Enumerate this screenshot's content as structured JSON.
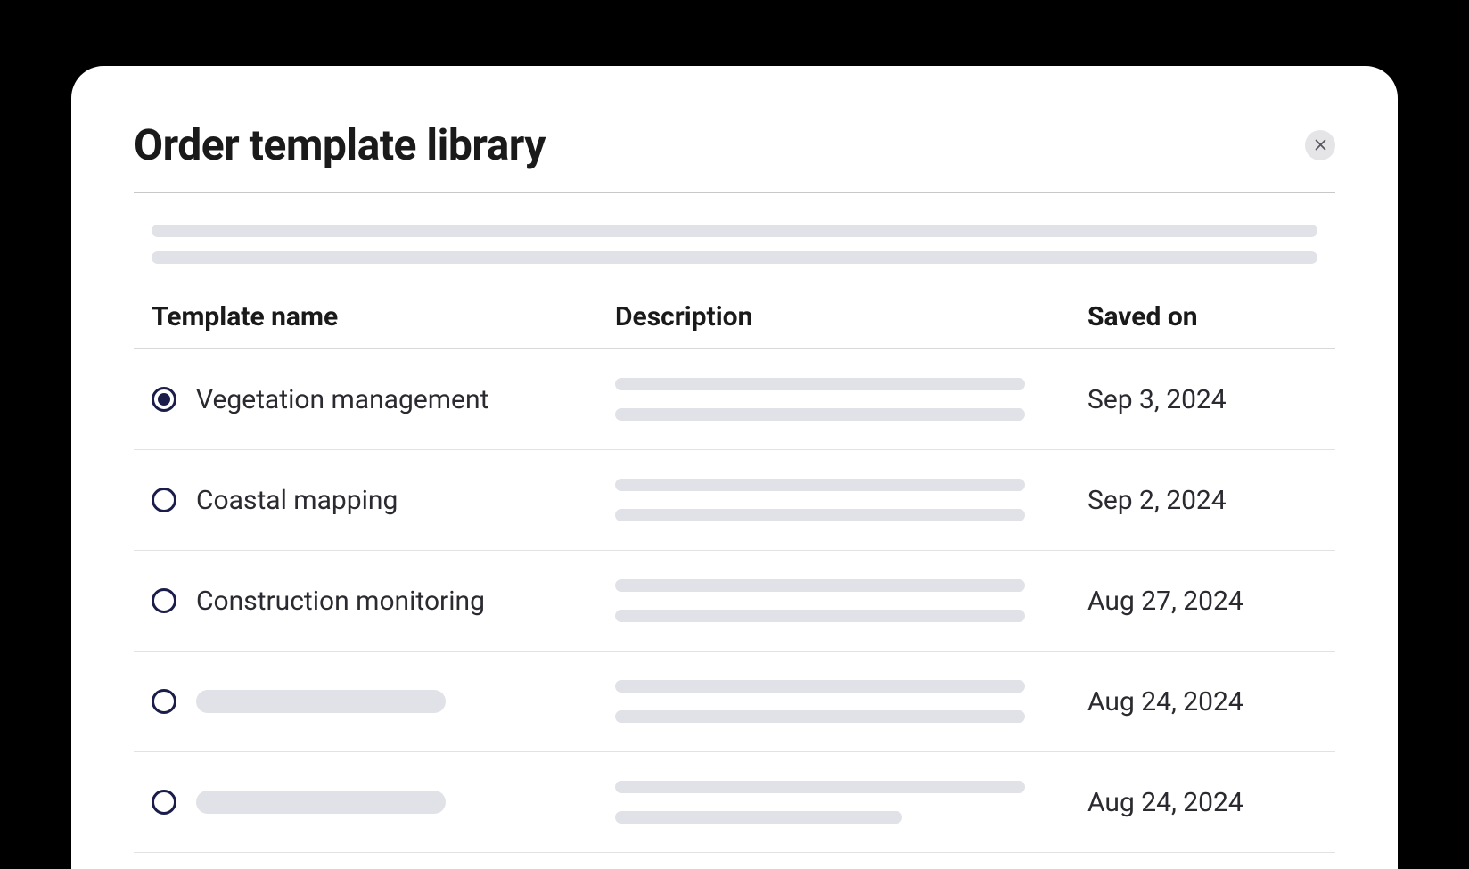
{
  "modal": {
    "title": "Order template library"
  },
  "table": {
    "headers": {
      "name": "Template name",
      "description": "Description",
      "saved": "Saved on"
    },
    "rows": [
      {
        "name": "Vegetation management",
        "saved": "Sep 3, 2024",
        "selected": true
      },
      {
        "name": "Coastal mapping",
        "saved": "Sep 2, 2024",
        "selected": false
      },
      {
        "name": "Construction monitoring",
        "saved": "Aug 27, 2024",
        "selected": false
      },
      {
        "name": "",
        "saved": "Aug 24, 2024",
        "selected": false
      },
      {
        "name": "",
        "saved": "Aug 24, 2024",
        "selected": false
      }
    ]
  }
}
